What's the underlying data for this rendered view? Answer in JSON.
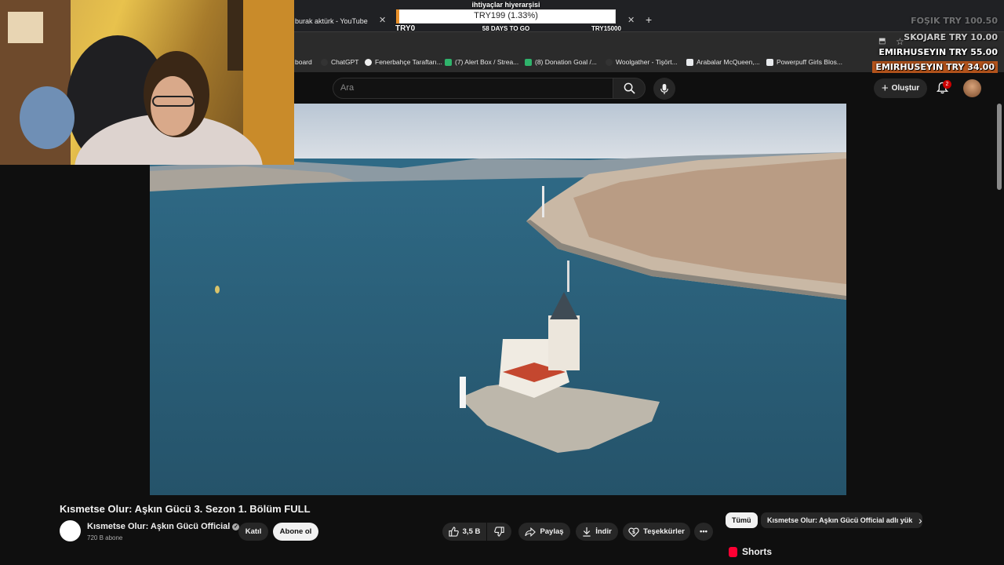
{
  "browser": {
    "tabs": [
      {
        "title": "burak aktürk - YouTube"
      }
    ],
    "bookmarks": [
      {
        "label": "board"
      },
      {
        "label": "ChatGPT"
      },
      {
        "label": "Fenerbahçe Taraftarı..."
      },
      {
        "label": "(7) Alert Box / Strea..."
      },
      {
        "label": "(8) Donation Goal /..."
      },
      {
        "label": "Woolgather - Tişört..."
      },
      {
        "label": "Arabalar McQueen,..."
      },
      {
        "label": "Powerpuff Girls Blos..."
      }
    ]
  },
  "overlay": {
    "goal": {
      "title": "ihtiyaçlar hiyerarşisi",
      "amount_text": "TRY199 (1.33%)",
      "progress_fraction": 0.0133,
      "start": "TRY0",
      "days_left": "58 DAYS TO GO",
      "target": "TRY15000"
    },
    "donations": [
      {
        "name": "FOŞIK",
        "amount": "TRY 100.50"
      },
      {
        "name": "SKOJARE",
        "amount": "TRY 10.00"
      },
      {
        "name": "EMIRHUSEYIN",
        "amount": "TRY 55.00"
      },
      {
        "name": "EMIRHUSEYIN",
        "amount": "TRY 34.00"
      }
    ]
  },
  "youtube": {
    "search_placeholder": "Ara",
    "create_label": "Oluştur",
    "notifications_count": "2",
    "video": {
      "title": "Kısmetse Olur: Aşkın Gücü 3. Sezon 1. Bölüm FULL"
    },
    "channel": {
      "name": "Kısmetse Olur: Aşkın Gücü Official",
      "subscribers": "720 B abone",
      "join_label": "Katıl",
      "subscribe_label": "Abone ol"
    },
    "actions": {
      "like_count": "3,5 B",
      "share_label": "Paylaş",
      "download_label": "İndir",
      "thanks_label": "Teşekkürler"
    },
    "chips": [
      {
        "label": "Tümü"
      },
      {
        "label": "Kısmetse Olur: Aşkın Gücü Official adlı yük"
      }
    ],
    "shorts_label": "Shorts"
  },
  "colors": {
    "bg": "#0f0f0f",
    "goal_fill": "#e8902a",
    "donation_highlight": "#b5541c",
    "badge": "#cc0000"
  }
}
